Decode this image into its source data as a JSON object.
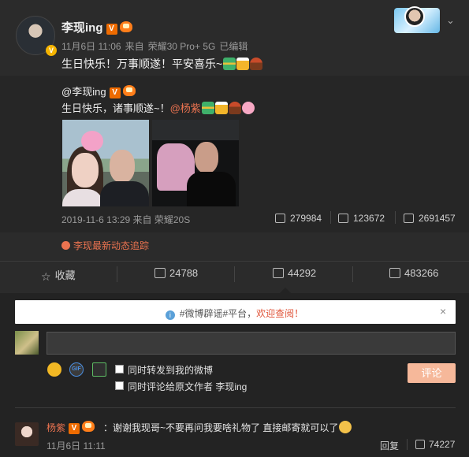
{
  "post": {
    "author": "李现ing",
    "date": "11月6日 11:06",
    "source_prefix": "来自",
    "source": "荣耀30 Pro+ 5G",
    "edited": "已编辑",
    "text": "生日快乐！万事顺遂！平安喜乐~"
  },
  "repost": {
    "author": "@李现ing",
    "text": "生日快乐，诸事顺遂~！",
    "mention": "@杨紫",
    "date": "2019-11-6 13:29 来自 荣耀20S",
    "reposts": "279984",
    "comments": "123672",
    "likes": "2691457"
  },
  "tracking_link": "李现最新动态追踪",
  "actions": {
    "favorite": "收藏",
    "repost": "24788",
    "comment": "44292",
    "like": "483266"
  },
  "notice": {
    "text": "#微博辟谣#平台，",
    "link": "欢迎查阅！"
  },
  "composer": {
    "input_value": "",
    "forward_label": "同时转发到我的微博",
    "comment_origin_label": "同时评论给原文作者 李现ing",
    "submit_label": "评论"
  },
  "comments": [
    {
      "name": "杨紫",
      "text": "：谢谢我现哥~不要再问我要啥礼物了 直接邮寄就可以了",
      "date": "11月6日 11:11",
      "reply": "回复",
      "likes": "74227"
    }
  ],
  "icons": {
    "vip": "v-verified-icon",
    "crown": "vip-crown-icon",
    "chevron": "chevron-down-icon"
  },
  "colors": {
    "accent": "#eb7350",
    "background": "#2b2b2b",
    "submit": "#f6b89a"
  }
}
